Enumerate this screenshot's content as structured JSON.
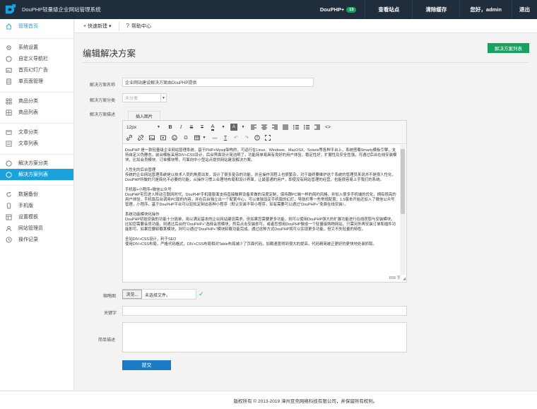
{
  "header": {
    "app_title": "DouPHP轻量级企业网站管理系统",
    "version_label": "DouPHP+",
    "version_badge": "13",
    "view_site": "查看站点",
    "clear_cache": "清除缓存",
    "greeting": "您好，admin",
    "logout": "退出"
  },
  "sidebar": {
    "home": "管理首页",
    "items": [
      {
        "label": "系统设置",
        "icon": "gear-icon"
      },
      {
        "label": "自定义导航栏",
        "icon": "nav-icon"
      },
      {
        "label": "首页幻灯广告",
        "icon": "slide-icon"
      },
      {
        "label": "单页面管理",
        "icon": "page-icon"
      },
      {
        "label": "商品分类",
        "icon": "grid-icon"
      },
      {
        "label": "商品列表",
        "icon": "list-icon"
      },
      {
        "label": "文章分类",
        "icon": "doc-icon"
      },
      {
        "label": "文章列表",
        "icon": "doc-list-icon"
      },
      {
        "label": "解决方案分类",
        "icon": "circle-icon"
      },
      {
        "label": "解决方案列表",
        "icon": "circle-icon"
      },
      {
        "label": "数据备份",
        "icon": "refresh-icon"
      },
      {
        "label": "手机版",
        "icon": "phone-icon"
      },
      {
        "label": "设置模板",
        "icon": "template-icon"
      },
      {
        "label": "网站管理员",
        "icon": "user-icon"
      },
      {
        "label": "操作记录",
        "icon": "log-icon"
      }
    ]
  },
  "subbar": {
    "quick_new": "+ 快速新建 ▾",
    "help": "帮助中心"
  },
  "main": {
    "title": "编辑解决方案",
    "list_button": "解决方案列表",
    "form": {
      "name_label": "解决方案名称",
      "name_value": "企业网站建设解决方案由DouPHP提供",
      "category_label": "解决方案分类",
      "category_value": "未分类",
      "desc_label": "解决方案描述",
      "upload_image": "插入图片",
      "font_size": "12px",
      "word_count": "858 字",
      "thumb_label": "缩略图",
      "browse": "浏览...",
      "no_file": "未选择文件。",
      "keywords_label": "关键字",
      "summary_label": "简单描述",
      "submit": "提交"
    },
    "content_paragraphs": [
      "DouPHP 是一款轻量级企业网站管理系统，基于PHP+Mysql架构的，可运行在Linux、Windows、MacOSX、Solaris等各种平台上，系统搭载Smarty模板引擎，支持自定义伪静态，前台模板采用DIV+CSS设计，后台界面设计简洁明了，功能简单易具有良好的用户体验，稳定性好，扩展性及安全性强，可通过后台在线安装模块，比如会员模块、订单模块等，可面向中小型站点提供网站建设解决方案。",
      "人性化的后台管理\n传统的企业网站管理系统是以技术人员的角度出发，设计了很多复杂的功能，并且操作流程上也很繁杂，对于最终要维护这个系统的管理员来说并不是很人性化，DouPHP所做的只是简化不必要的功能，从操作习惯上合理地布局和设计界面，让最普通的用户，即使没有网站管理的经营，也能很容易上手我们的系统。",
      "手机版+小程序+微信公众号\nDouPHP宅您进入移动互联网时代，DouPHP手机版版面支持直接触屏设备来做的深度定制，保持跟PC端一样的简约风格，并加入很多手机端的优化，拥有很高的用户体验，手机版后台调用PC版的内容，并在后台独立出一个配置中心，可以单独设定手机版的幻灯，导航栏等一些常规配置；1.5版本开始还加入了微信公众号管理，小程序，基于DouPHP平台可以轻松定制出各种小程序（默认安装不带小程序，如有需要可以通过\"DouPHP+\"免费在线安装）。",
      "系统功能模块化操作\nDouPHP初始安装的功能十分简单，用以满足基本的企业网站建设需求，但如果您需要更多功能，则可以使用DouPHP强大的扩展功能进行在线获取与安装模块，比如您需要会员功能，则通过后台的\"DouPHP+\"选择会员模块，然后点击安装即可。或者您想用DouPHP做成一个轻量级购物网站，只需另外再安装订单和插件功能即可。如果您要卸载某模块，则可以通过\"DouPHP+\"模块卸载功能完成。通过这种方式DouPHP将可以实现更多功能，但又不失轻量的特性。",
      "全站DIV+CSS设计，利于SEO\n使用DIV+CSS布局，严格代码格式，DIV+CSS布局相对Table布局减少了页面代码，加载速度得到很大的提高，代码精简被正更好的更快地处录抓取。"
    ]
  },
  "footer": {
    "copyright": "版权所有 © 2013-2019 漳州豆壳网络科技有限公司，并保留所有权利。"
  },
  "colors": {
    "topbar": "#1f2d3d",
    "accent": "#1aa2dc",
    "green": "#19a15f",
    "submit": "#1a7bc4"
  }
}
